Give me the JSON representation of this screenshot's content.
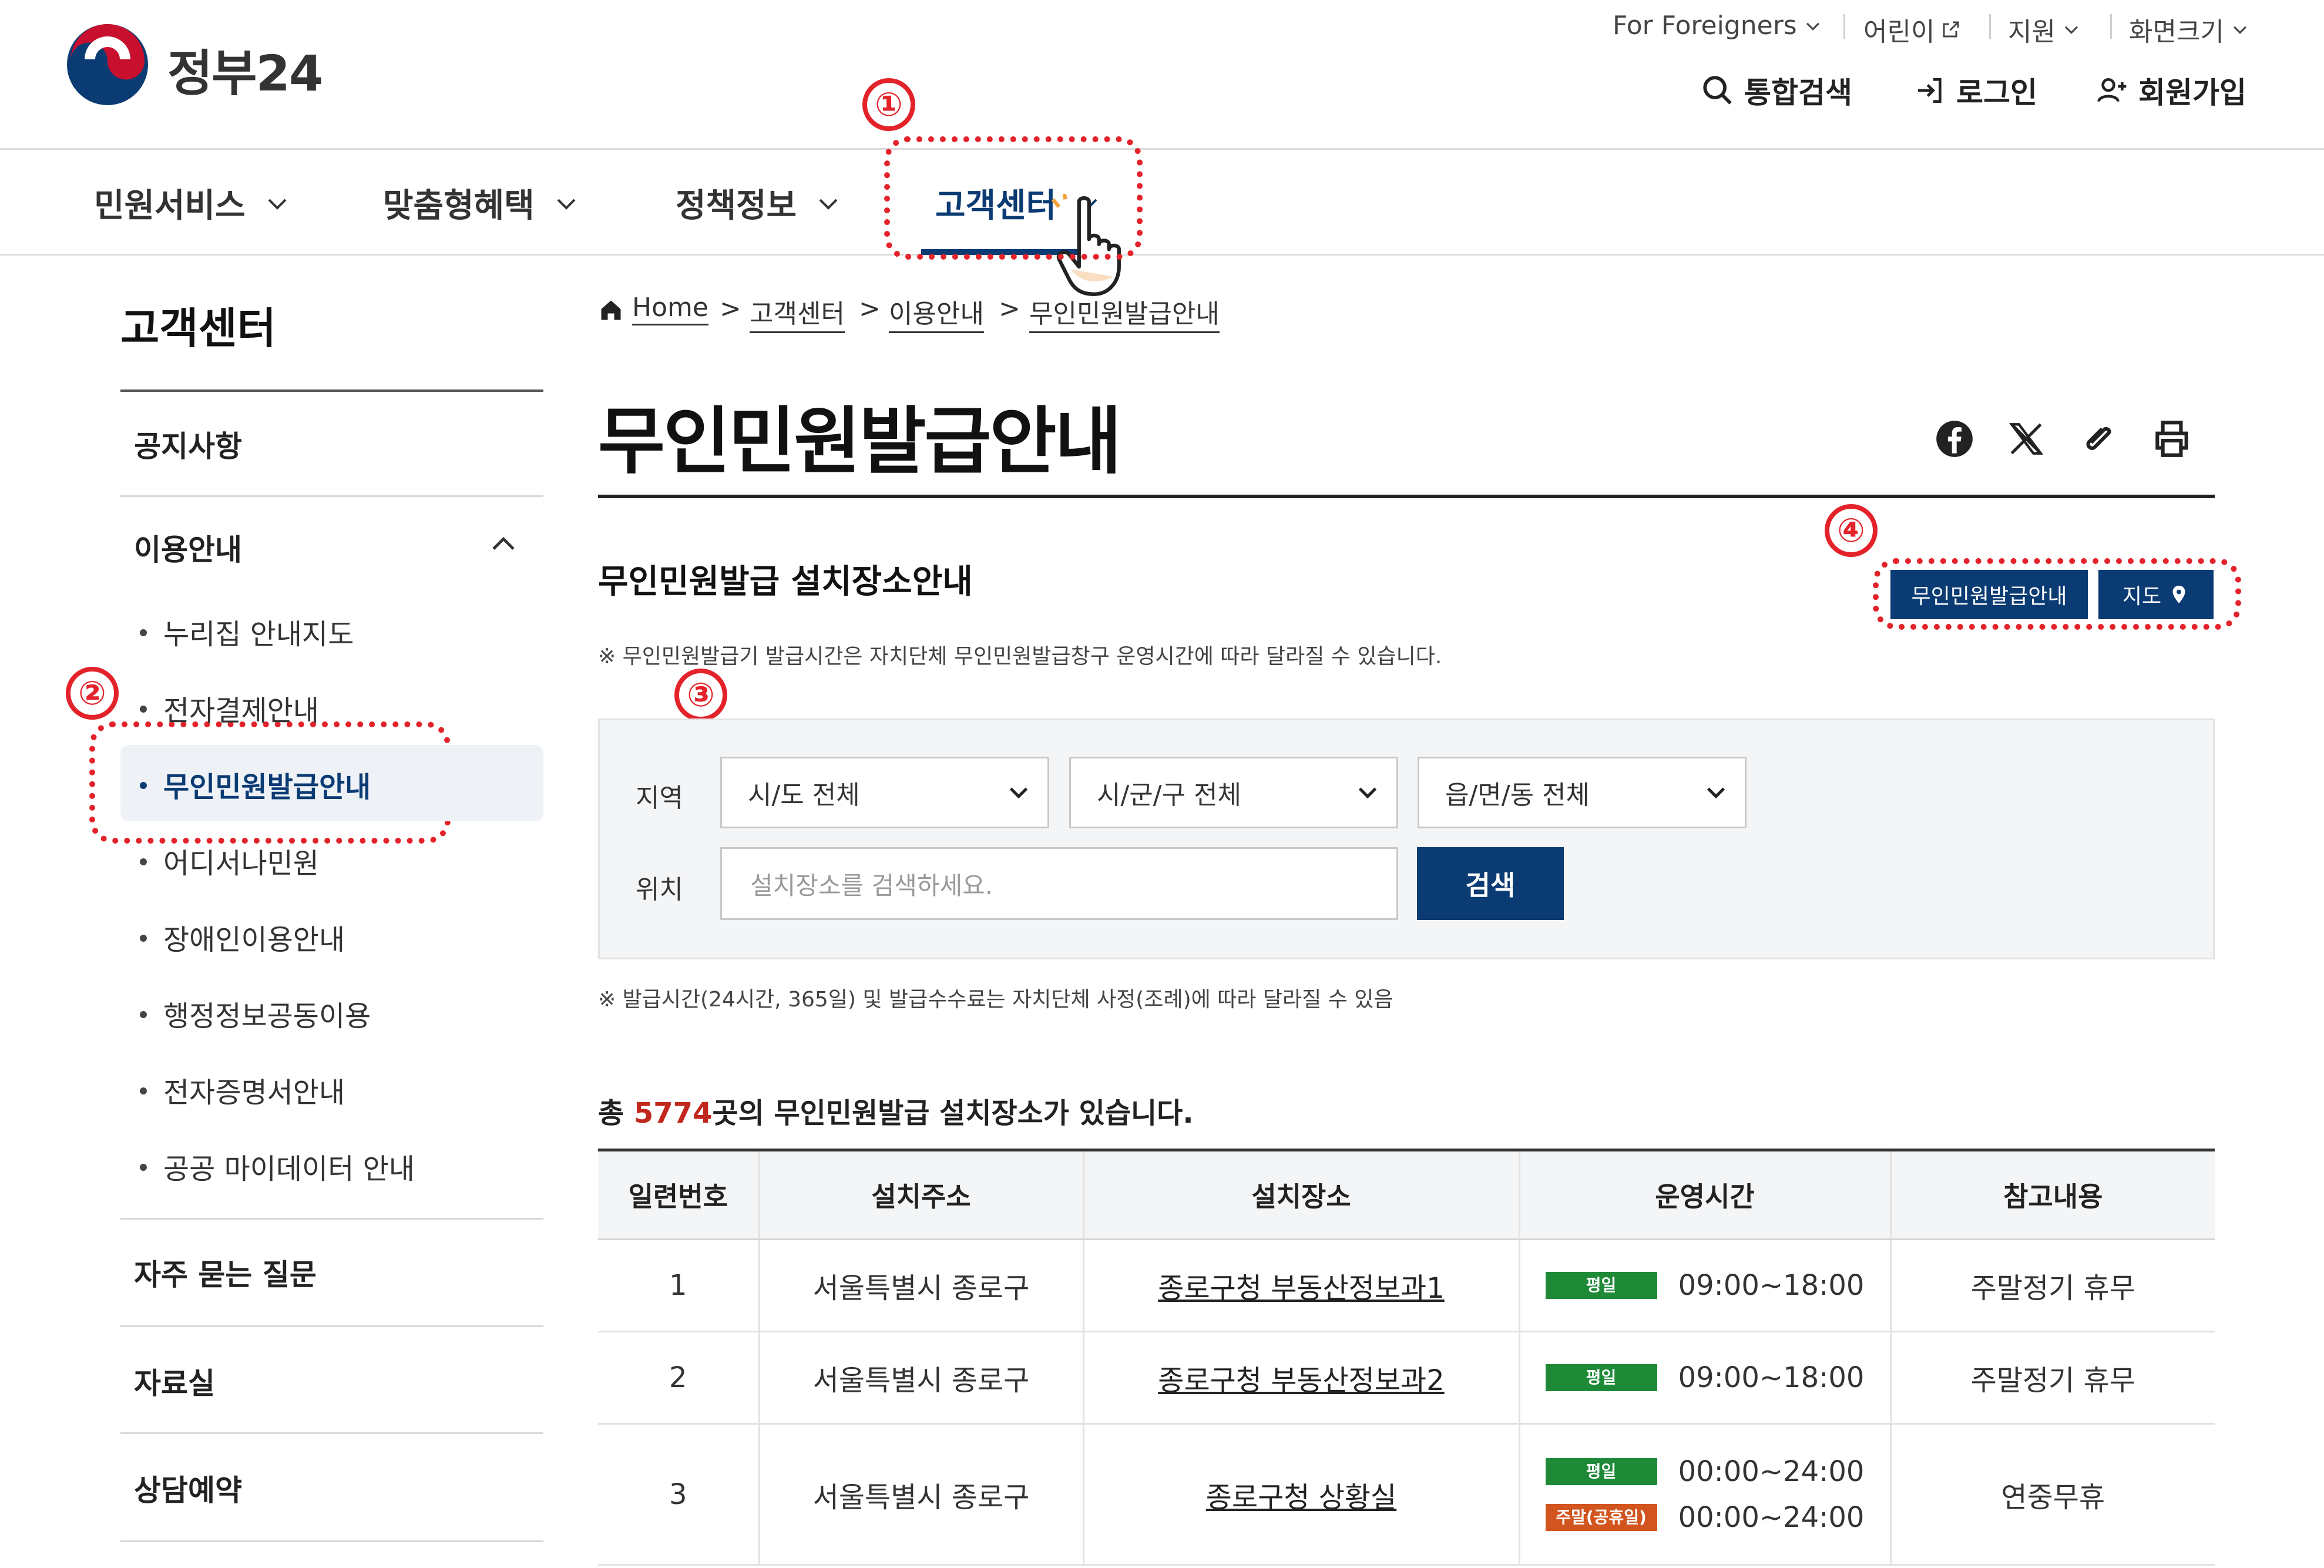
{
  "header": {
    "logo_text": "정부24",
    "util": {
      "foreigners": "For Foreigners",
      "kids": "어린이",
      "support": "지원",
      "font_size": "화면크기"
    },
    "actions": {
      "search": "통합검색",
      "login": "로그인",
      "signup": "회원가입"
    }
  },
  "gnb": [
    {
      "label": "민원서비스"
    },
    {
      "label": "맞춤형혜택"
    },
    {
      "label": "정책정보"
    },
    {
      "label": "고객센터",
      "active": true
    }
  ],
  "annotations": {
    "step1": "①",
    "step2": "②",
    "step3": "③",
    "step4": "④",
    "highlight_color": "#e3222a"
  },
  "sidebar": {
    "title": "고객센터",
    "items": {
      "notice": "공지사항",
      "usage": "이용안내",
      "faq": "자주 묻는 질문",
      "library": "자료실",
      "consult": "상담예약"
    },
    "usage_sub": [
      "누리집 안내지도",
      "전자결제안내",
      "무인민원발급안내",
      "어디서나민원",
      "장애인이용안내",
      "행정정보공동이용",
      "전자증명서안내",
      "공공 마이데이터 안내"
    ]
  },
  "breadcrumb": [
    "Home",
    "고객센터",
    "이용안내",
    "무인민원발급안내"
  ],
  "breadcrumb_sep": ">",
  "main": {
    "title": "무인민원발급안내",
    "section_title": "무인민원발급 설치장소안내",
    "btn_guide": "무인민원발급안내",
    "btn_map": "지도",
    "note_top": "※ 무인민원발급기 발급시간은 자치단체 무인민원발급창구 운영시간에 따라 달라질 수 있습니다.",
    "note_bottom": "※ 발급시간(24시간, 365일) 및 발급수수료는 자치단체 사정(조례)에 따라 달라질 수 있음"
  },
  "search": {
    "region_label": "지역",
    "location_label": "위치",
    "sido": "시/도 전체",
    "sigungu": "시/군/구 전체",
    "eupmyeondong": "읍/면/동 전체",
    "placeholder": "설치장소를 검색하세요.",
    "button": "검색"
  },
  "summary": {
    "prefix": "총 ",
    "count": "5774",
    "suffix": "곳의 무인민원발급 설치장소가 있습니다."
  },
  "table": {
    "headers": [
      "일련번호",
      "설치주소",
      "설치장소",
      "운영시간",
      "참고내용"
    ],
    "rows": [
      {
        "no": "1",
        "address": "서울특별시 종로구",
        "place": "종로구청 부동산정보과1",
        "hours": [
          {
            "badge": "평일",
            "kind": "weekday",
            "time": "09:00~18:00"
          }
        ],
        "remark": "주말정기 휴무"
      },
      {
        "no": "2",
        "address": "서울특별시 종로구",
        "place": "종로구청 부동산정보과2",
        "hours": [
          {
            "badge": "평일",
            "kind": "weekday",
            "time": "09:00~18:00"
          }
        ],
        "remark": "주말정기 휴무"
      },
      {
        "no": "3",
        "address": "서울특별시 종로구",
        "place": "종로구청 상황실",
        "hours": [
          {
            "badge": "평일",
            "kind": "weekday",
            "time": "00:00~24:00"
          },
          {
            "badge": "주말(공휴일)",
            "kind": "weekend",
            "time": "00:00~24:00"
          }
        ],
        "remark": "연중무휴"
      }
    ]
  },
  "colors": {
    "brand_navy": "#0b3b73",
    "count_red": "#c2271e",
    "weekday_green": "#1e8a38",
    "weekend_orange": "#d2541e"
  }
}
